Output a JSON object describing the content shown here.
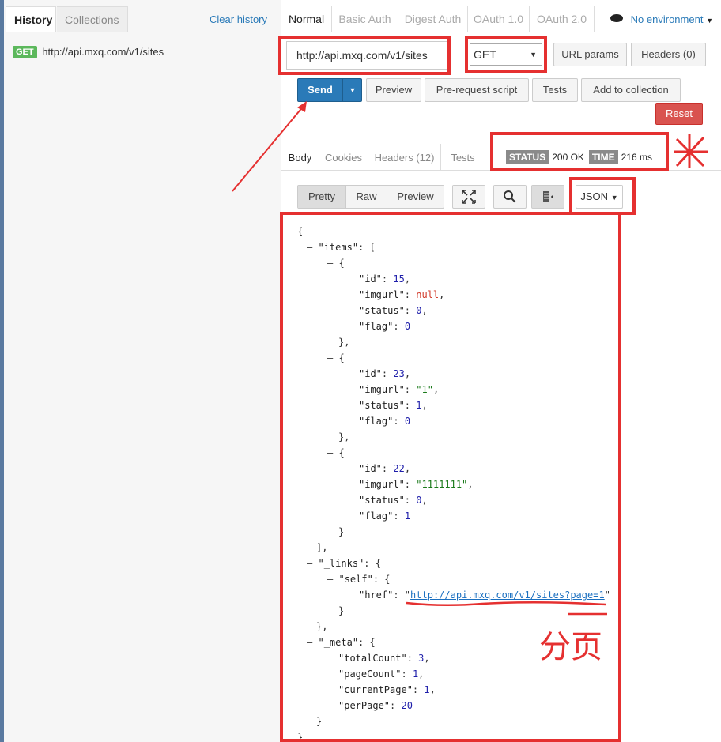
{
  "sidebar": {
    "tabs": [
      "History",
      "Collections"
    ],
    "clear_history": "Clear history",
    "history_items": [
      {
        "method": "GET",
        "url": "http://api.mxq.com/v1/sites"
      }
    ]
  },
  "auth_tabs": [
    "Normal",
    "Basic Auth",
    "Digest Auth",
    "OAuth 1.0",
    "OAuth 2.0"
  ],
  "environment": {
    "label": "No environment"
  },
  "request": {
    "url": "http://api.mxq.com/v1/sites",
    "method": "GET",
    "url_params": "URL params",
    "headers": "Headers (0)"
  },
  "actions": {
    "send": "Send",
    "preview": "Preview",
    "prerequest": "Pre-request script",
    "tests": "Tests",
    "add_collection": "Add to collection",
    "reset": "Reset"
  },
  "response_tabs": [
    "Body",
    "Cookies",
    "Headers (12)",
    "Tests"
  ],
  "status": {
    "status_label": "STATUS",
    "status_value": "200 OK",
    "time_label": "TIME",
    "time_value": "216 ms"
  },
  "view_modes": [
    "Pretty",
    "Raw",
    "Preview"
  ],
  "format": "JSON",
  "annotation": "分页",
  "json_body": {
    "items": [
      {
        "id": "15",
        "imgurl": "null",
        "status": "0",
        "flag": "0"
      },
      {
        "id": "23",
        "imgurl": "\"1\"",
        "status": "1",
        "flag": "0"
      },
      {
        "id": "22",
        "imgurl": "\"1111111\"",
        "status": "0",
        "flag": "1"
      }
    ],
    "self_href": "http://api.mxq.com/v1/sites?page=1",
    "meta": {
      "totalCount": "3",
      "pageCount": "1",
      "currentPage": "1",
      "perPage": "20"
    }
  }
}
